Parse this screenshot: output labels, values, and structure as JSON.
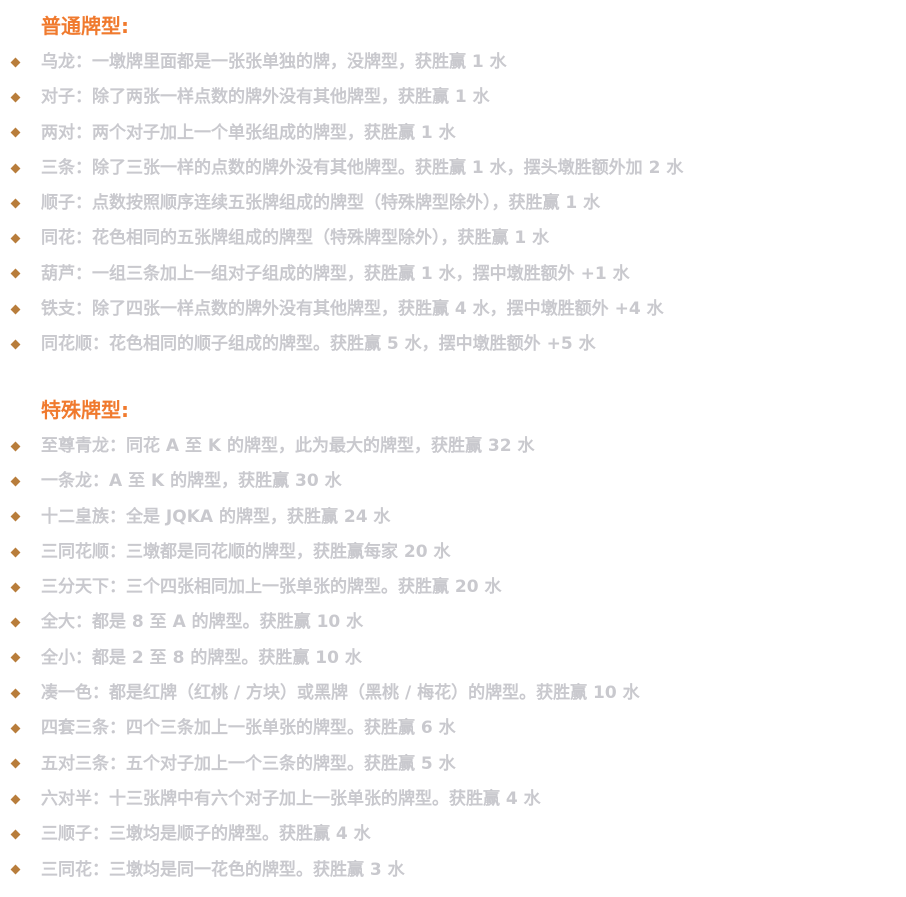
{
  "normal": {
    "title": "普通牌型:",
    "items": [
      "乌龙：一墩牌里面都是一张张单独的牌，没牌型，获胜赢 1 水",
      "对子：除了两张一样点数的牌外没有其他牌型，获胜赢 1 水",
      "两对：两个对子加上一个单张组成的牌型，获胜赢 1 水",
      "三条：除了三张一样的点数的牌外没有其他牌型。获胜赢 1 水，摆头墩胜额外加 2 水",
      "顺子：点数按照顺序连续五张牌组成的牌型（特殊牌型除外），获胜赢 1 水",
      "同花：花色相同的五张牌组成的牌型（特殊牌型除外），获胜赢 1 水",
      "葫芦：一组三条加上一组对子组成的牌型，获胜赢 1 水，摆中墩胜额外 +1 水",
      "铁支：除了四张一样点数的牌外没有其他牌型，获胜赢 4 水，摆中墩胜额外 +4 水",
      "同花顺：花色相同的顺子组成的牌型。获胜赢 5 水，摆中墩胜额外 +5 水"
    ]
  },
  "special": {
    "title": "特殊牌型:",
    "items": [
      "至尊青龙：同花 A 至 K 的牌型，此为最大的牌型，获胜赢 32 水",
      "一条龙：A 至 K 的牌型，获胜赢 30 水",
      "十二皇族：全是 JQKA 的牌型，获胜赢 24 水",
      "三同花顺：三墩都是同花顺的牌型，获胜赢每家 20 水",
      "三分天下：三个四张相同加上一张单张的牌型。获胜赢 20 水",
      "全大：都是 8 至 A 的牌型。获胜赢 10 水",
      "全小：都是 2 至 8 的牌型。获胜赢 10 水",
      "凑一色：都是红牌（红桃 / 方块）或黑牌（黑桃 / 梅花）的牌型。获胜赢 10 水",
      "四套三条：四个三条加上一张单张的牌型。获胜赢 6 水",
      "五对三条：五个对子加上一个三条的牌型。获胜赢 5 水",
      "六对半：十三张牌中有六个对子加上一张单张的牌型。获胜赢 4 水",
      "三顺子：三墩均是顺子的牌型。获胜赢 4 水",
      "三同花：三墩均是同一花色的牌型。获胜赢 3 水"
    ]
  },
  "colors": {
    "title": "#f07a2e",
    "text": "#c9c9ce",
    "bullet": "#b87d3b"
  },
  "icons": {
    "bullet": "diamond-bullet-icon"
  }
}
